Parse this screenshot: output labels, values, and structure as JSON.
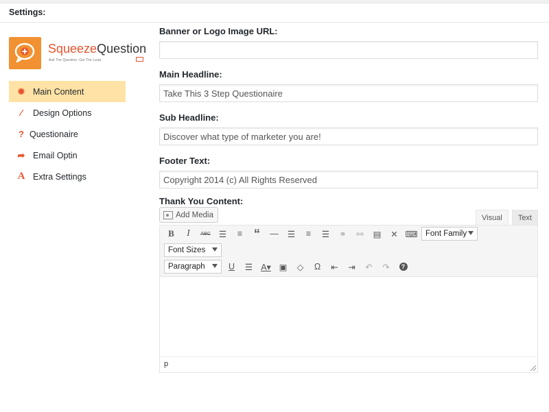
{
  "panel": {
    "title": "Settings:"
  },
  "logo": {
    "name_part1": "Squeeze",
    "name_part2": "Question",
    "tagline": "Ask The Question. Get The Lead."
  },
  "sidebar": {
    "items": [
      {
        "label": "Main Content",
        "icon": "gear-icon",
        "active": true
      },
      {
        "label": "Design Options",
        "icon": "magic-wand-icon",
        "active": false
      },
      {
        "label": "Questionaire",
        "icon": "question-mark-icon",
        "active": false
      },
      {
        "label": "Email Optin",
        "icon": "share-arrow-icon",
        "active": false
      },
      {
        "label": "Extra Settings",
        "icon": "font-a-icon",
        "active": false
      }
    ]
  },
  "form": {
    "banner_label": "Banner or Logo Image URL:",
    "banner_value": "",
    "headline_label": "Main Headline:",
    "headline_value": "Take This 3 Step Questionaire",
    "subheadline_label": "Sub Headline:",
    "subheadline_value": "Discover what type of marketer you are!",
    "footer_label": "Footer Text:",
    "footer_value": "Copyright 2014 (c) All Rights Reserved",
    "thankyou_label": "Thank You Content:"
  },
  "editor": {
    "add_media_label": "Add Media",
    "tab_visual": "Visual",
    "tab_text": "Text",
    "font_family": "Font Family",
    "font_sizes": "Font Sizes",
    "paragraph": "Paragraph",
    "bold": "B",
    "italic": "I",
    "strike": "ABC",
    "underline": "U",
    "omega": "Ω",
    "help": "?",
    "status_path": "p"
  },
  "colors": {
    "accent": "#e8542e",
    "active_nav": "#ffe3a6",
    "logo_box": "#f19131"
  }
}
